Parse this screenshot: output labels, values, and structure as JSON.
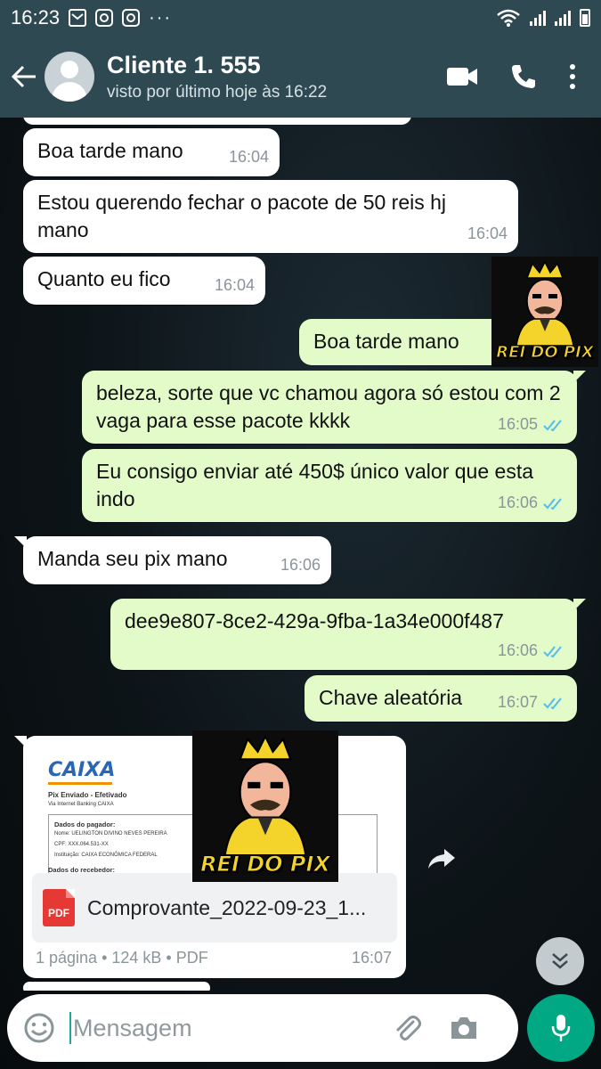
{
  "status_bar": {
    "time": "16:23",
    "dots": "···",
    "icons": [
      "gmail-icon",
      "instagram-icon",
      "instagram-icon",
      "wifi-icon",
      "signal-icon",
      "battery-icon"
    ]
  },
  "header": {
    "contact_name": "Cliente 1. 555",
    "last_seen": "visto por último hoje às 16:22",
    "icons": [
      "back-arrow-icon",
      "avatar-icon",
      "video-call-icon",
      "phone-icon",
      "more-vert-icon"
    ]
  },
  "messages": [
    {
      "direction": "in",
      "text": "Boa tarde mano",
      "time": "16:04"
    },
    {
      "direction": "in",
      "text": "Estou querendo fechar o pacote de 50 reis hj mano",
      "time": "16:04"
    },
    {
      "direction": "in",
      "text": "Quanto eu fico",
      "time": "16:04"
    },
    {
      "direction": "out",
      "text": "Boa tarde mano",
      "time": ""
    },
    {
      "direction": "out",
      "text": "beleza, sorte que vc chamou agora só estou com 2 vaga para esse pacote  kkkk",
      "time": "16:05",
      "status": "read"
    },
    {
      "direction": "out",
      "text": "Eu consigo enviar até 450$ único valor que esta indo",
      "time": "16:06",
      "status": "read"
    },
    {
      "direction": "in",
      "text": "Manda seu pix mano",
      "time": "16:06"
    },
    {
      "direction": "out",
      "text": "dee9e807-8ce2-429a-9fba-1a34e000f487",
      "time": "16:06",
      "status": "read"
    },
    {
      "direction": "out",
      "text": "Chave aleatória",
      "time": "16:07",
      "status": "read"
    }
  ],
  "stickers": {
    "label": "REI DO PIX"
  },
  "document": {
    "preview": {
      "bank": "CAIXA",
      "title": "Pix Enviado - Efetivado",
      "subtitle": "Via Internet Banking CAIXA",
      "payer_heading": "Dados do pagador:",
      "payer_name": "Nome: UELINGTON DIVINO NEVES PEREIRA",
      "payer_cpf": "CPF: XXX.064.531-XX",
      "payer_institution": "Instituição: CAIXA ECONÔMICA FEDERAL",
      "receiver_heading": "Dados do recebedor:"
    },
    "icon_label": "PDF",
    "file_name": "Comprovante_2022-09-23_1...",
    "info": "1 página • 124 kB • PDF",
    "time": "16:07"
  },
  "input": {
    "placeholder": "Mensagem"
  },
  "colors": {
    "header_bg": "#2f4953",
    "bubble_in": "#ffffff",
    "bubble_out": "#e2fbc9",
    "read_check": "#53bdeb",
    "mic_button": "#00a884",
    "sticker_yellow": "#f4d32a"
  }
}
